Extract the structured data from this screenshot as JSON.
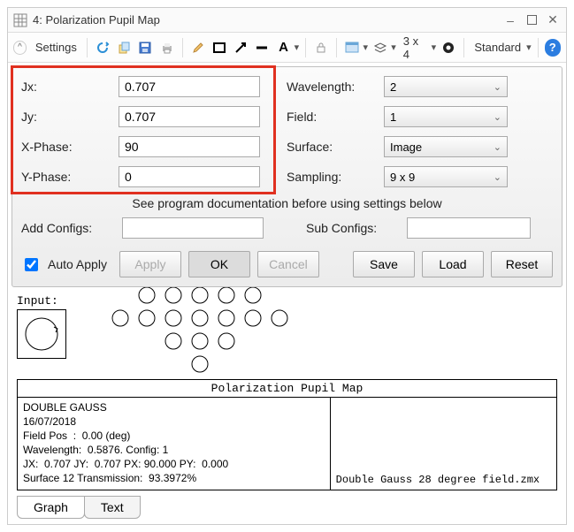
{
  "window": {
    "title": "4: Polarization Pupil Map"
  },
  "toolbar": {
    "settings_label": "Settings",
    "grid_label": "3 x 4",
    "mode_label": "Standard"
  },
  "form": {
    "jx": {
      "label": "Jx:",
      "value": "0.707"
    },
    "jy": {
      "label": "Jy:",
      "value": "0.707"
    },
    "xphase": {
      "label": "X-Phase:",
      "value": "90"
    },
    "yphase": {
      "label": "Y-Phase:",
      "value": "0"
    },
    "wavelength": {
      "label": "Wavelength:",
      "value": "2"
    },
    "field": {
      "label": "Field:",
      "value": "1"
    },
    "surface": {
      "label": "Surface:",
      "value": "Image"
    },
    "sampling": {
      "label": "Sampling:",
      "value": "9 x 9"
    },
    "doc_note": "See program documentation before using settings below",
    "add_configs_label": "Add Configs:",
    "sub_configs_label": "Sub Configs:"
  },
  "buttons": {
    "auto_apply": "Auto Apply",
    "apply": "Apply",
    "ok": "OK",
    "cancel": "Cancel",
    "save": "Save",
    "load": "Load",
    "reset": "Reset"
  },
  "canvas": {
    "input_label": "Input:"
  },
  "info": {
    "title": "Polarization Pupil Map",
    "line1": "DOUBLE GAUSS",
    "line2": "16/07/2018",
    "line3": "Field Pos  :  0.00 (deg)",
    "line4": "Wavelength:  0.5876. Config: 1",
    "line5": "JX:  0.707 JY:  0.707 PX: 90.000 PY:  0.000",
    "line6": "Surface 12 Transmission:  93.3972%",
    "filename": "Double Gauss 28 degree field.zmx"
  },
  "tabs": {
    "graph": "Graph",
    "text": "Text"
  }
}
